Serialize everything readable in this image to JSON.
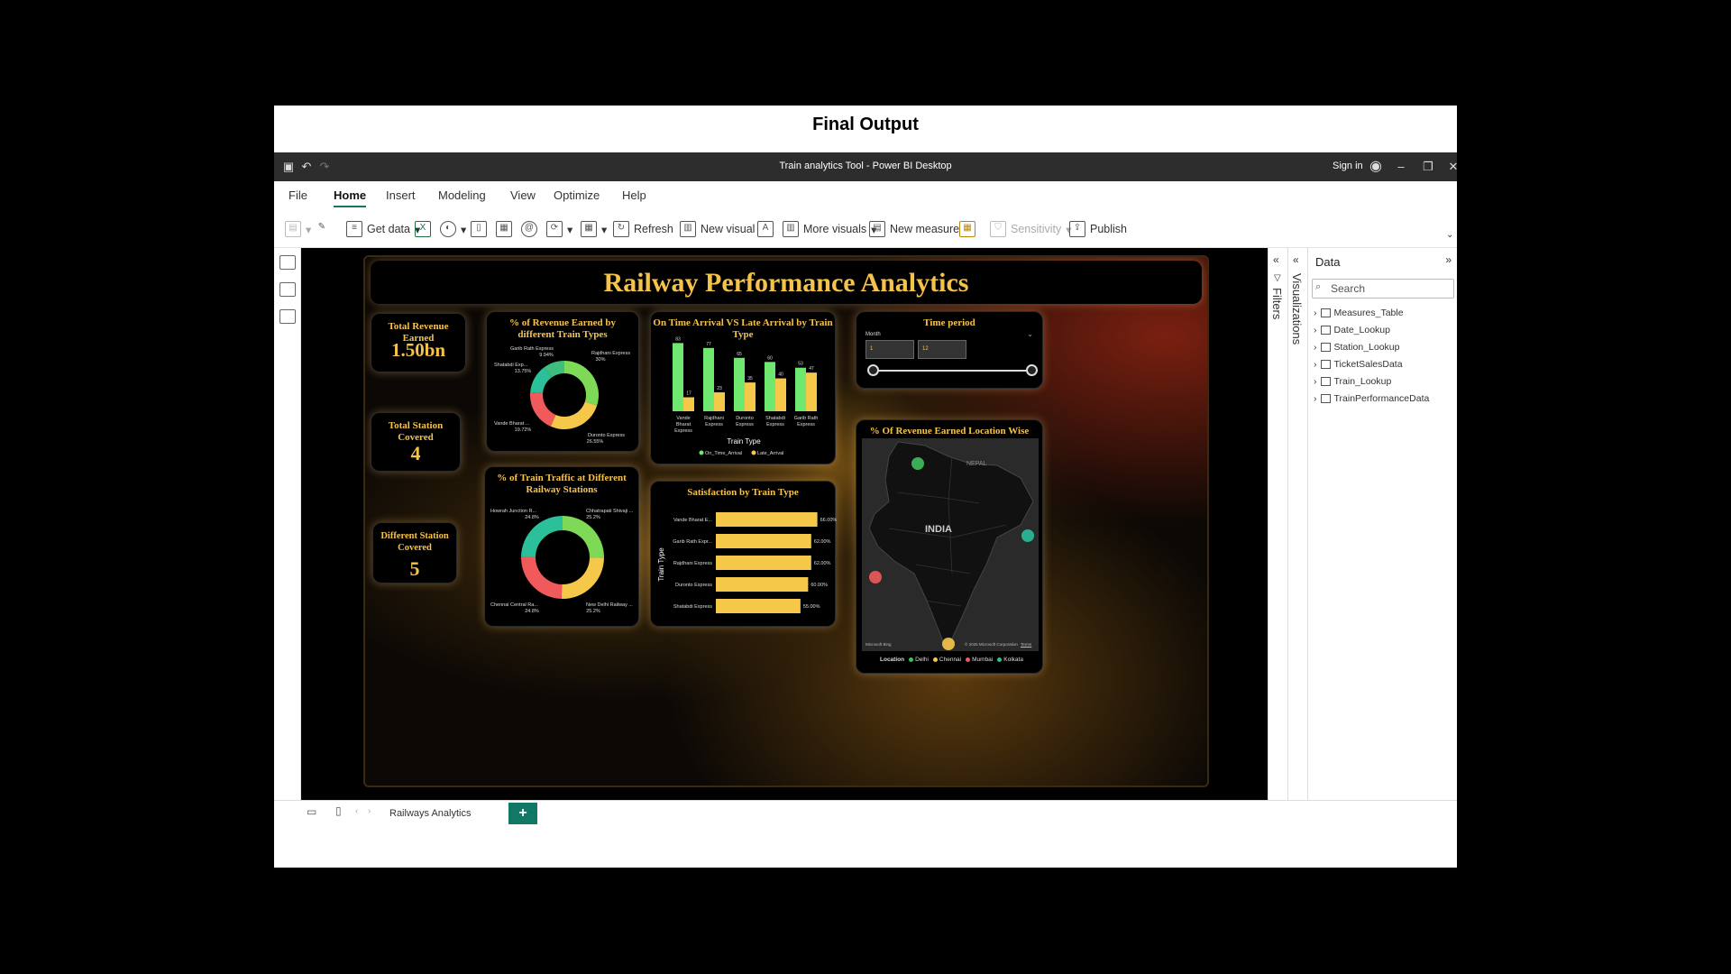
{
  "frame_title": "Final Output",
  "window": {
    "title": "Train analytics Tool - Power BI Desktop",
    "sign_in": "Sign in"
  },
  "menu": [
    "File",
    "Home",
    "Insert",
    "Modeling",
    "View",
    "Optimize",
    "Help"
  ],
  "ribbon": {
    "get_data": "Get data",
    "refresh": "Refresh",
    "new_visual": "New visual",
    "more_visuals": "More visuals",
    "new_measure": "New measure",
    "sensitivity": "Sensitivity",
    "publish": "Publish"
  },
  "report": {
    "title": "Railway Performance Analytics",
    "kpis": [
      {
        "label": "Total Revenue Earned",
        "value": "1.50bn"
      },
      {
        "label": "Total Station Covered",
        "value": "4"
      },
      {
        "label": "Different Station Covered",
        "value": "5"
      }
    ],
    "time_period": {
      "title": "Time period",
      "field": "Month",
      "from": "1",
      "to": "12"
    },
    "map": {
      "title": "% Of Revenue Earned Location Wise",
      "country": "INDIA",
      "neighbor": "NEPAL",
      "legend_title": "Location",
      "attribution": "© 2025 Microsoft Corporation",
      "terms": "Terms",
      "brand": "Microsoft Bing"
    }
  },
  "chart_data": [
    {
      "type": "pie",
      "donut": true,
      "title": "% of Revenue Earned by different Train Types",
      "labels": [
        "Rajdhani Express",
        "Duronto Express",
        "Vande Bharat ...",
        "Shatabdi Exp...",
        "Garib Rath Express"
      ],
      "values": [
        30,
        26.55,
        19.72,
        13.75,
        9.94
      ],
      "value_labels": [
        "30%",
        "26.55%",
        "19.72%",
        "13.75%",
        "9.94%"
      ],
      "colors": [
        "#7ed957",
        "#f6c84a",
        "#f05a5a",
        "#2bbf9a",
        "#3fbf7f"
      ]
    },
    {
      "type": "bar",
      "title": "On Time Arrival VS Late Arrival by Train Type",
      "categories": [
        "Vande Bharat Express",
        "Rajdhani Express",
        "Duronto Express",
        "Shatabdi Express",
        "Garib Rath Express"
      ],
      "category_lines": [
        [
          "Vande",
          "Bharat",
          "Express"
        ],
        [
          "Rajdhani",
          "Express"
        ],
        [
          "Duronto",
          "Express"
        ],
        [
          "Shatabdi",
          "Express"
        ],
        [
          "Garib Rath",
          "Express"
        ]
      ],
      "series": [
        {
          "name": "On_Time_Arrival",
          "values": [
            83,
            77,
            65,
            60,
            53
          ],
          "color": "#6ee86e"
        },
        {
          "name": "Late_Arrival",
          "values": [
            17,
            23,
            35,
            40,
            47
          ],
          "color": "#f6c84a"
        }
      ],
      "xlabel": "Train Type",
      "ylim": [
        0,
        90
      ]
    },
    {
      "type": "pie",
      "donut": true,
      "title": "% of Train Traffic at Different Railway Stations",
      "labels": [
        "Chhatrapati Shivaji ...",
        "New Delhi Railway ...",
        "Chennai Central Ra...",
        "Howrah Junction R..."
      ],
      "values": [
        25.2,
        25.2,
        24.8,
        24.8
      ],
      "value_labels": [
        "25.2%",
        "25.2%",
        "24.8%",
        "24.8%"
      ],
      "colors": [
        "#7ed957",
        "#f6c84a",
        "#f05a5a",
        "#2bbf9a"
      ]
    },
    {
      "type": "bar",
      "orientation": "horizontal",
      "title": "Satisfaction by Train Type",
      "categories": [
        "Vande Bharat E...",
        "Garib Rath Expr...",
        "Rajdhani Express",
        "Duronto Express",
        "Shatabdi Express"
      ],
      "values": [
        66,
        62,
        62,
        60,
        55
      ],
      "value_labels": [
        "66.00%",
        "62.00%",
        "62.00%",
        "60.00%",
        "55.00%"
      ],
      "ylabel": "Train Type",
      "xlim": [
        0,
        80
      ],
      "color": "#f6c84a"
    },
    {
      "type": "scatter",
      "title": "% Of Revenue Earned Location Wise",
      "series": [
        {
          "name": "Delhi",
          "color": "#3fbf5f"
        },
        {
          "name": "Chennai",
          "color": "#f6c84a"
        },
        {
          "name": "Mumbai",
          "color": "#f05a5a"
        },
        {
          "name": "Kolkata",
          "color": "#2bbf9a"
        }
      ]
    }
  ],
  "pages": [
    {
      "label": "Railways Analytics"
    }
  ],
  "data_pane": {
    "title": "Data",
    "search_placeholder": "Search",
    "tables": [
      "Measures_Table",
      "Date_Lookup",
      "Station_Lookup",
      "TicketSalesData",
      "Train_Lookup",
      "TrainPerformanceData"
    ]
  },
  "panes": {
    "filters": "Filters",
    "visualizations": "Visualizations"
  }
}
